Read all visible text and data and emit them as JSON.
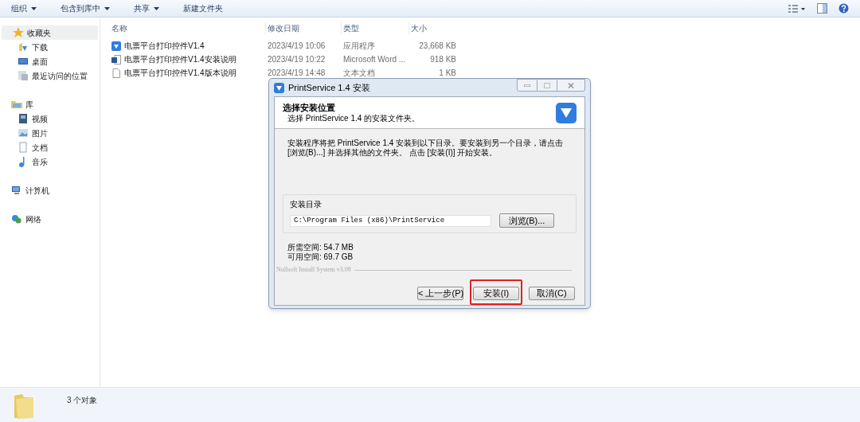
{
  "toolbar": {
    "items": [
      {
        "label": "组织",
        "dropdown": true
      },
      {
        "label": "包含到库中",
        "dropdown": true
      },
      {
        "label": "共享",
        "dropdown": true
      },
      {
        "label": "新建文件夹",
        "dropdown": false
      }
    ]
  },
  "sidebar": {
    "groups": [
      {
        "label": "收藏夹",
        "selected": true,
        "children": [
          {
            "label": "下载",
            "selected": false
          },
          {
            "label": "桌面",
            "selected": false
          },
          {
            "label": "最近访问的位置",
            "selected": false
          }
        ]
      },
      {
        "label": "库",
        "selected": false,
        "children": [
          {
            "label": "视频",
            "selected": false
          },
          {
            "label": "图片",
            "selected": false
          },
          {
            "label": "文档",
            "selected": false
          },
          {
            "label": "音乐",
            "selected": false
          }
        ]
      },
      {
        "label": "计算机",
        "selected": false
      },
      {
        "label": "网络",
        "selected": false
      }
    ]
  },
  "file_list": {
    "columns": [
      "名称",
      "修改日期",
      "类型",
      "大小"
    ],
    "rows": [
      {
        "kind": "app",
        "name": "电票平台打印控件V1.4",
        "date": "2023/4/19 10:06",
        "type": "应用程序",
        "size": "23,668 KB"
      },
      {
        "kind": "doc",
        "name": "电票平台打印控件V1.4安装说明",
        "date": "2023/4/19 10:22",
        "type": "Microsoft Word ...",
        "size": "918 KB"
      },
      {
        "kind": "txt",
        "name": "电票平台打印控件V1.4版本说明",
        "date": "2023/4/19 14:48",
        "type": "文本文档",
        "size": "1 KB"
      }
    ]
  },
  "dialog": {
    "title": "PrintService 1.4 安装",
    "heading": "选择安装位置",
    "subheading": "选择 PrintService 1.4 的安装文件夹。",
    "description": "安装程序将把 PrintService 1.4 安装到以下目录。要安装到另一个目录，请点击 [浏览(B)...] 并选择其他的文件夹。 点击 [安装(I)] 开始安装。",
    "group_label": "安装目录",
    "path": "C:\\Program Files (x86)\\PrintService",
    "browse_button": "浏览(B)...",
    "space": [
      "所需空间: 54.7 MB",
      "可用空间: 69.7 GB"
    ],
    "branding": "Nullsoft Install System v3.08",
    "buttons": [
      {
        "label": "< 上一步(P)",
        "highlighted": false
      },
      {
        "label": "安装(I)",
        "highlighted": true
      },
      {
        "label": "取消(C)",
        "highlighted": false
      }
    ]
  },
  "status_bar": {
    "text": "3 个对象"
  }
}
